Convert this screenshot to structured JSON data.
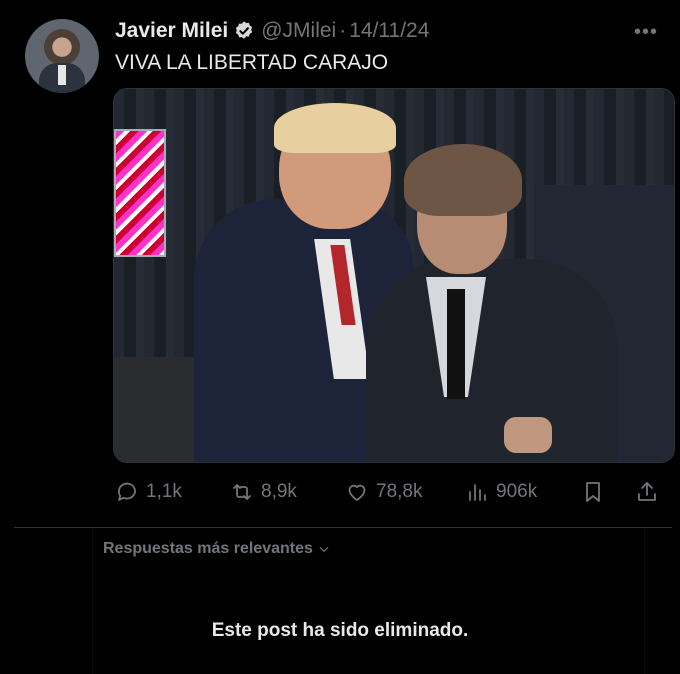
{
  "post": {
    "author_name": "Javier Milei",
    "handle": "@JMilei",
    "separator": "·",
    "date": "14/11/24",
    "more_label": "•••",
    "text": "VIVA LA LIBERTAD CARAJO"
  },
  "actions": {
    "replies": "1,1k",
    "reposts": "8,9k",
    "likes": "78,8k",
    "views": "906k"
  },
  "replies_section": {
    "sort_label": "Respuestas más relevantes",
    "deleted_message": "Este post ha sido eliminado."
  },
  "colors": {
    "background": "#000000",
    "text_primary": "#e7e9ea",
    "text_secondary": "#71767b",
    "verified_badge": "#d6d9db",
    "divider": "#2f3336"
  }
}
